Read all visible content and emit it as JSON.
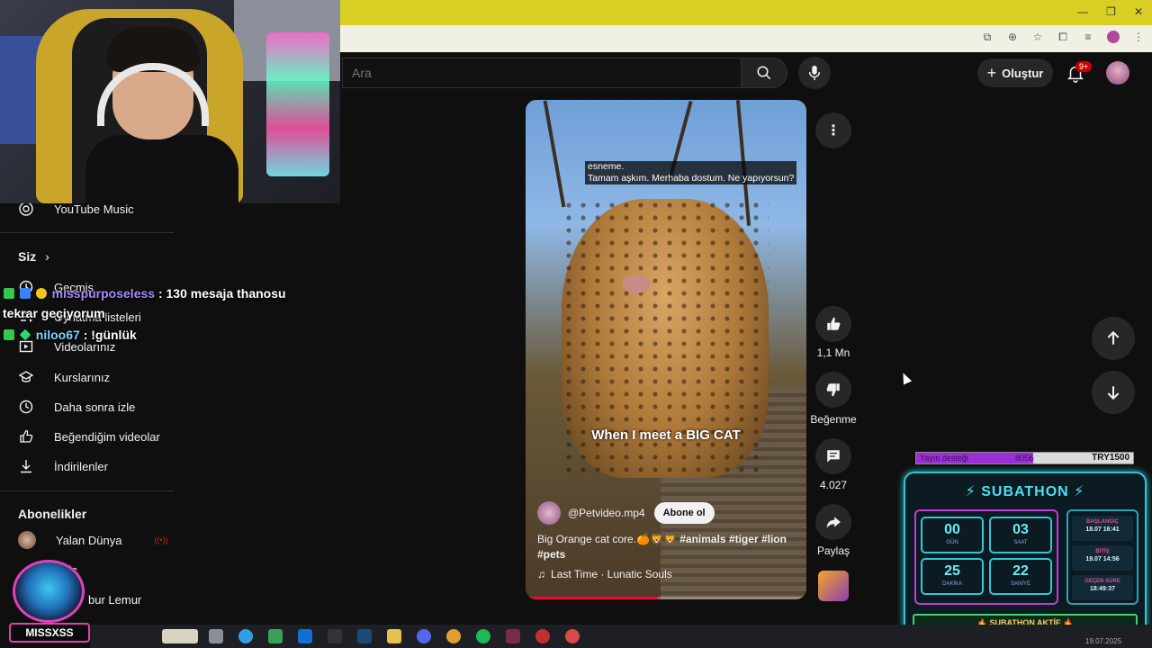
{
  "search": {
    "placeholder": "Ara"
  },
  "header": {
    "create_label": "Oluştur",
    "notif_badge": "9+"
  },
  "sidebar": {
    "youtube_music": "YouTube Music",
    "you_heading": "Siz",
    "items": [
      {
        "label": "Geçmiş",
        "icon": "history-icon"
      },
      {
        "label": "Oynatma listeleri",
        "icon": "playlist-icon"
      },
      {
        "label": "Videolarınız",
        "icon": "play-icon"
      },
      {
        "label": "Kurslarınız",
        "icon": "graduation-icon"
      },
      {
        "label": "Daha sonra izle",
        "icon": "clock-icon"
      },
      {
        "label": "Beğendiğim videolar",
        "icon": "thumb-up-icon"
      },
      {
        "label": "İndirilenler",
        "icon": "download-icon"
      }
    ],
    "subs_heading": "Abonelikler",
    "subs": [
      {
        "label": "Yalan Dünya",
        "badge": "((•))"
      },
      {
        "label": "Bilic"
      },
      {
        "label": "bur Lemur"
      }
    ]
  },
  "chat": [
    {
      "user": "misspurposeless",
      "message": ": 130 mesaja thanosu",
      "continuation": "tekrar geçiyorum"
    },
    {
      "user": "niloo67",
      "message": ": !günlük"
    }
  ],
  "video": {
    "caption_line1": "esneme.",
    "caption_line2": "Tamam aşkım.  Merhaba dostum.  Ne yapıyorsun?",
    "overlay_text": "When I meet a BIG CAT",
    "channel": "@Petvideo.mp4",
    "subscribe": "Abone ol",
    "description_plain": "Big Orange cat core.",
    "description_emoji": "🍊🦁🦁",
    "description_tags": "#animals #tiger #lion #pets",
    "music": "Last Time · Lunatic Souls",
    "progress": 0.47
  },
  "actions": {
    "likes": "1,1 Mn",
    "dislike": "Beğenme",
    "comments": "4.027",
    "share": "Paylaş"
  },
  "subathon": {
    "goal_label": "Yayın desteği",
    "goal_mid": "805₺",
    "goal_target": "TRY1500",
    "goal_fraction": 0.54,
    "title": "⚡ SUBATHON ⚡",
    "timer": [
      {
        "value": "00",
        "unit": "GÜN"
      },
      {
        "value": "03",
        "unit": "SAAT"
      },
      {
        "value": "25",
        "unit": "DAKİKA"
      },
      {
        "value": "22",
        "unit": "SANİYE"
      }
    ],
    "info": [
      {
        "key": "BAŞLANGIÇ",
        "value": "18.07 16:41"
      },
      {
        "key": "BİTİŞ",
        "value": "19.07 14:56"
      },
      {
        "key": "GEÇEN SÜRE",
        "value": "18:49:37"
      }
    ],
    "active": "🔥 SUBATHON AKTİF 🔥"
  },
  "streamer": {
    "name": "MISSXSS"
  },
  "taskbar": {
    "clock": "19.07.2025"
  },
  "colors": {
    "accent": "#ff0033",
    "chrome_yellow": "#d9ce23",
    "subathon_cyan": "#2ac6d8",
    "subathon_pink": "#c43ad8"
  }
}
